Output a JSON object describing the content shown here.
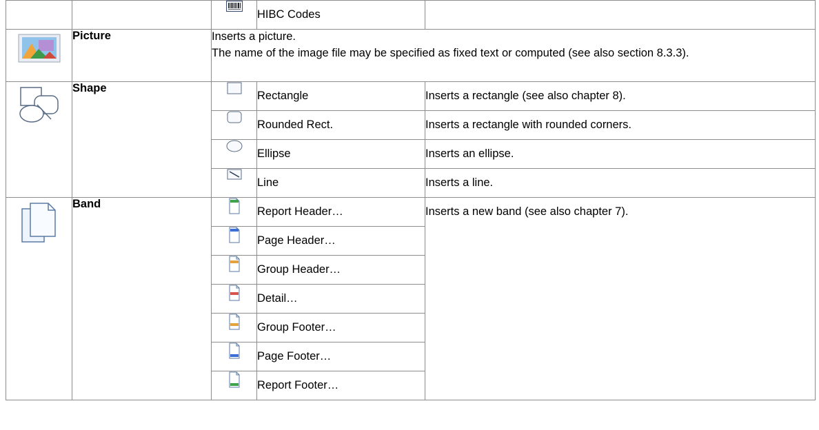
{
  "rows": {
    "hibc": {
      "label": "HIBC Codes",
      "icon": "barcode-icon"
    },
    "picture": {
      "name": "Picture",
      "icon": "picture-icon",
      "line1": "Inserts a picture.",
      "line2": "The name of the image file may be specified as fixed text or computed (see also section 8.3.3)."
    },
    "shape": {
      "name": "Shape",
      "icon": "shapes-icon",
      "items": [
        {
          "label": "Rectangle",
          "desc": "Inserts a rectangle (see also chapter 8).",
          "icon": "rectangle-icon"
        },
        {
          "label": "Rounded Rect.",
          "desc": "Inserts a rectangle with rounded corners.",
          "icon": "rounded-rect-icon"
        },
        {
          "label": "Ellipse",
          "desc": "Inserts an ellipse.",
          "icon": "ellipse-icon"
        },
        {
          "label": "Line",
          "desc": "Inserts a line.",
          "icon": "line-icon"
        }
      ]
    },
    "band": {
      "name": "Band",
      "icon": "band-pages-icon",
      "desc": "Inserts a new band (see also chapter 7).",
      "items": [
        {
          "label": "Report Header…",
          "icon": "report-header-icon",
          "color": "#3fa34d",
          "pos": "top"
        },
        {
          "label": "Page Header…",
          "icon": "page-header-icon",
          "color": "#3b6fd6",
          "pos": "top"
        },
        {
          "label": "Group Header…",
          "icon": "group-header-icon",
          "color": "#e6a23c",
          "pos": "upper"
        },
        {
          "label": "Detail…",
          "icon": "detail-icon",
          "color": "#d9534f",
          "pos": "middle"
        },
        {
          "label": "Group Footer…",
          "icon": "group-footer-icon",
          "color": "#e6a23c",
          "pos": "lower"
        },
        {
          "label": "Page Footer…",
          "icon": "page-footer-icon",
          "color": "#3b6fd6",
          "pos": "bottom"
        },
        {
          "label": "Report Footer…",
          "icon": "report-footer-icon",
          "color": "#3fa34d",
          "pos": "bottom"
        }
      ]
    }
  }
}
